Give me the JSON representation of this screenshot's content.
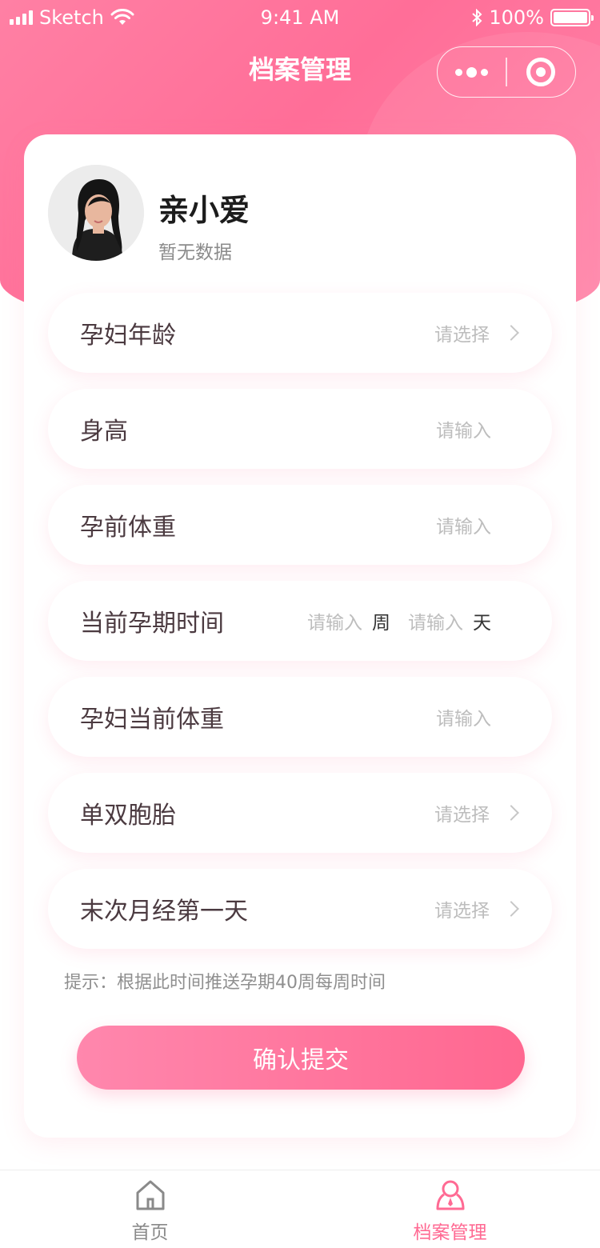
{
  "status_bar": {
    "carrier": "Sketch",
    "time": "9:41 AM",
    "battery": "100%"
  },
  "header": {
    "title": "档案管理"
  },
  "profile": {
    "name": "亲小爱",
    "subtitle": "暂无数据"
  },
  "form": {
    "rows": [
      {
        "label": "孕妇年龄",
        "placeholder": "请选择",
        "type": "select"
      },
      {
        "label": "身高",
        "placeholder": "请输入",
        "type": "input"
      },
      {
        "label": "孕前体重",
        "placeholder": "请输入",
        "type": "input"
      },
      {
        "label": "当前孕期时间",
        "type": "dual-input",
        "week_placeholder": "请输入",
        "week_unit": "周",
        "day_placeholder": "请输入",
        "day_unit": "天"
      },
      {
        "label": "孕妇当前体重",
        "placeholder": "请输入",
        "type": "input"
      },
      {
        "label": "单双胞胎",
        "placeholder": "请选择",
        "type": "select"
      },
      {
        "label": "末次月经第一天",
        "placeholder": "请选择",
        "type": "select"
      }
    ],
    "hint": "提示：根据此时间推送孕期40周每周时间",
    "submit_label": "确认提交"
  },
  "tabbar": {
    "items": [
      {
        "label": "首页",
        "icon": "home-icon",
        "active": false
      },
      {
        "label": "档案管理",
        "icon": "profile-icon",
        "active": true
      }
    ]
  },
  "colors": {
    "accent": "#ff6e98",
    "tab_active": "#ff6a93",
    "tab_inactive": "#8a8a8a"
  }
}
